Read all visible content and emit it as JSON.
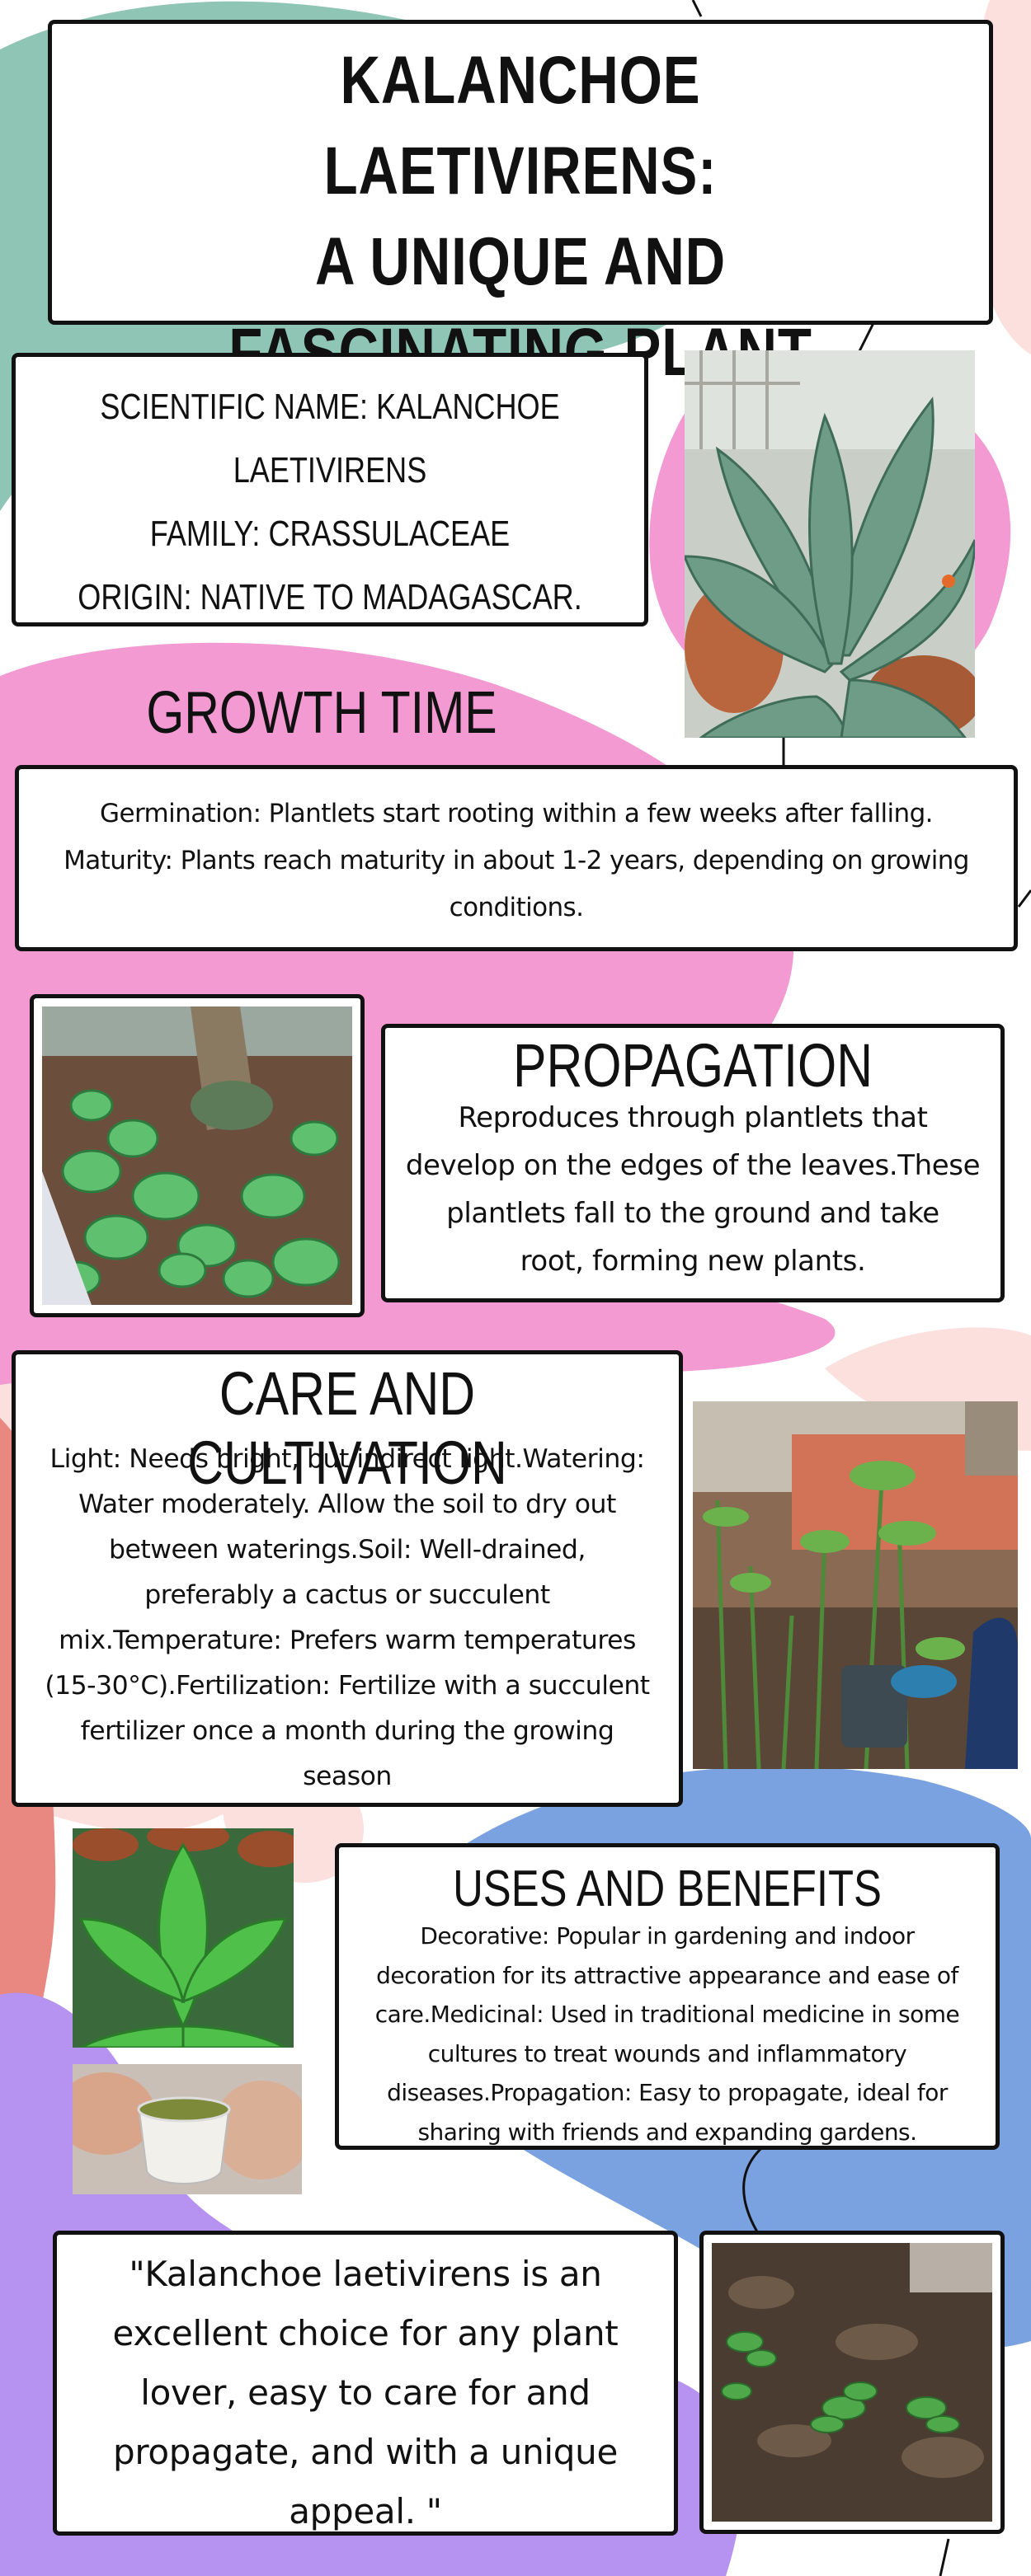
{
  "header": {
    "title_line1": "KALANCHOE LAETIVIRENS:",
    "title_line2": "A UNIQUE AND",
    "title_line3": "FASCINATING PLANT"
  },
  "info": {
    "line1": "SCIENTIFIC NAME: KALANCHOE",
    "line2": "LAETIVIRENS",
    "line3": "FAMILY: CRASSULACEAE",
    "line4": "ORIGIN: NATIVE TO MADAGASCAR."
  },
  "growth": {
    "heading": "GROWTH TIME",
    "line1": "Germination: Plantlets start rooting within a few weeks after falling.",
    "line2": "Maturity: Plants reach maturity in about 1-2 years, depending on growing",
    "line3": "conditions."
  },
  "propagation": {
    "heading": "PROPAGATION",
    "line1": "Reproduces through plantlets that",
    "line2": "develop on the edges of the leaves.These",
    "line3": "plantlets fall to the ground and take",
    "line4": "root, forming new plants."
  },
  "care": {
    "heading": "CARE AND CULTIVATION",
    "line1": "Light: Needs bright, but indirect light.Watering:",
    "line2": "Water moderately. Allow the soil to dry out",
    "line3": "between waterings.Soil: Well-drained,",
    "line4": "preferably a cactus or succulent",
    "line5": "mix.Temperature: Prefers warm temperatures",
    "line6": "(15-30°C).Fertilization: Fertilize with a succulent",
    "line7": "fertilizer once a month during the growing",
    "line8": "season"
  },
  "uses": {
    "heading": "USES AND BENEFITS",
    "line1": "Decorative: Popular in gardening and indoor",
    "line2": "decoration for its attractive appearance and ease of",
    "line3": "care.Medicinal: Used in traditional medicine in some",
    "line4": "cultures to treat wounds and inflammatory",
    "line5": "diseases.Propagation: Easy to propagate, ideal for",
    "line6": "sharing with friends and expanding gardens."
  },
  "quote": {
    "line1": "\"Kalanchoe laetivirens is an",
    "line2": "excellent choice for any plant",
    "line3": "lover, easy to care for and",
    "line4": "propagate, and with a unique",
    "line5": "appeal. \""
  },
  "colors": {
    "teal": "#8fc5b4",
    "pink": "#f49ad2",
    "peach": "#fbe0de",
    "coral": "#e98880",
    "blue": "#7ba2e0",
    "lavender": "#b693f0"
  }
}
